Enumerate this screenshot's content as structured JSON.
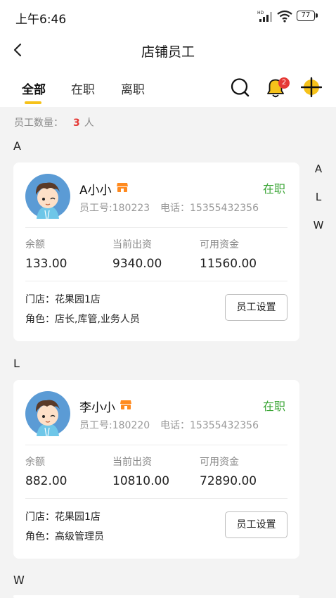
{
  "status_bar": {
    "time": "上午6:46",
    "network": "HD",
    "battery": "77"
  },
  "header": {
    "title": "店铺员工"
  },
  "tabs": [
    {
      "label": "全部"
    },
    {
      "label": "在职"
    },
    {
      "label": "离职"
    }
  ],
  "notification_count": "2",
  "summary": {
    "label": "员工数量：",
    "count": "3",
    "unit": "人"
  },
  "index_letters": [
    "A",
    "L",
    "W"
  ],
  "section_letters": [
    "A",
    "L",
    "W"
  ],
  "employees": [
    {
      "name": "A小小",
      "status": "在职",
      "employee_no": "员工号:180223",
      "phone": "电话：15355432356",
      "stats": [
        {
          "label": "余额",
          "value": "133.00"
        },
        {
          "label": "当前出资",
          "value": "9340.00"
        },
        {
          "label": "可用资金",
          "value": "11560.00"
        }
      ],
      "store": "门店：花果园1店",
      "role": "角色：店长,库管,业务人员",
      "button": "员工设置"
    },
    {
      "name": "李小小",
      "status": "在职",
      "employee_no": "员工号:180220",
      "phone": "电话：15355432356",
      "stats": [
        {
          "label": "余额",
          "value": "882.00"
        },
        {
          "label": "当前出资",
          "value": "10810.00"
        },
        {
          "label": "可用资金",
          "value": "72890.00"
        }
      ],
      "store": "门店：花果园1店",
      "role": "角色：高级管理员",
      "button": "员工设置"
    }
  ],
  "colors": {
    "accent": "#f6c21a",
    "status_active": "#3aa535",
    "badge": "#e53935",
    "store_icon": "#ff8a1f"
  }
}
